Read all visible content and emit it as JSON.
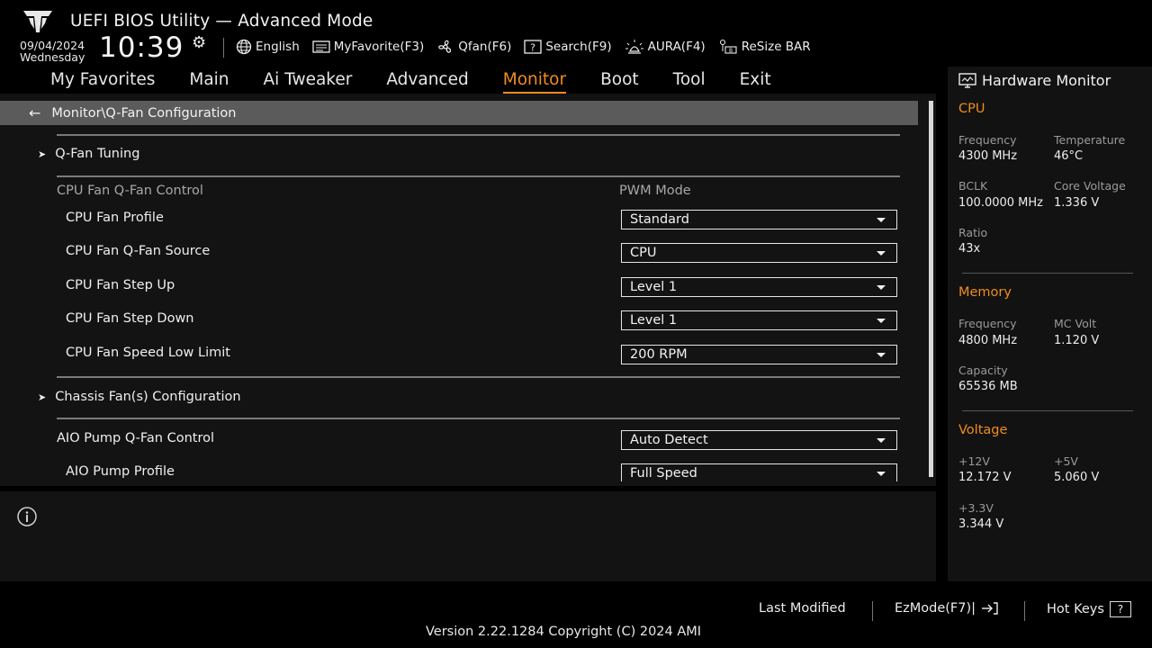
{
  "header": {
    "title": "UEFI BIOS Utility — Advanced Mode",
    "date": "09/04/2024",
    "weekday": "Wednesday",
    "time": "10:39",
    "toolbar": [
      {
        "label": "English",
        "icon": "globe-icon"
      },
      {
        "label": "MyFavorite(F3)",
        "icon": "favorite-list-icon"
      },
      {
        "label": "Qfan(F6)",
        "icon": "fan-icon"
      },
      {
        "label": "Search(F9)",
        "icon": "search-help-icon"
      },
      {
        "label": "AURA(F4)",
        "icon": "aura-light-icon"
      },
      {
        "label": "ReSize BAR",
        "icon": "resize-bar-icon"
      }
    ]
  },
  "nav": {
    "items": [
      "My Favorites",
      "Main",
      "Ai Tweaker",
      "Advanced",
      "Monitor",
      "Boot",
      "Tool",
      "Exit"
    ],
    "active": "Monitor"
  },
  "main": {
    "breadcrumb": "Monitor\\Q-Fan Configuration",
    "qfan_tuning": "Q-Fan Tuning",
    "cpu_group_label": "CPU Fan Q-Fan Control",
    "cpu_group_value": "PWM Mode",
    "cpu_rows": [
      {
        "label": "CPU Fan Profile",
        "value": "Standard"
      },
      {
        "label": "CPU Fan Q-Fan Source",
        "value": "CPU"
      },
      {
        "label": "CPU Fan Step Up",
        "value": "Level 1"
      },
      {
        "label": "CPU Fan Step Down",
        "value": "Level 1"
      },
      {
        "label": "CPU Fan Speed Low Limit",
        "value": "200 RPM"
      }
    ],
    "chassis": "Chassis Fan(s) Configuration",
    "aio_rows": [
      {
        "label": "AIO Pump Q-Fan Control",
        "value": "Auto Detect"
      },
      {
        "label": "AIO Pump Profile",
        "value": "Full Speed"
      }
    ]
  },
  "hw": {
    "title": "Hardware Monitor",
    "cpu": {
      "heading": "CPU",
      "frequency_label": "Frequency",
      "frequency": "4300 MHz",
      "temperature_label": "Temperature",
      "temperature": "46°C",
      "bclk_label": "BCLK",
      "bclk": "100.0000 MHz",
      "core_voltage_label": "Core Voltage",
      "core_voltage": "1.336 V",
      "ratio_label": "Ratio",
      "ratio": "43x"
    },
    "memory": {
      "heading": "Memory",
      "frequency_label": "Frequency",
      "frequency": "4800 MHz",
      "mc_volt_label": "MC Volt",
      "mc_volt": "1.120 V",
      "capacity_label": "Capacity",
      "capacity": "65536 MB"
    },
    "voltage": {
      "heading": "Voltage",
      "v12_label": "+12V",
      "v12": "12.172 V",
      "v5_label": "+5V",
      "v5": "5.060 V",
      "v33_label": "+3.3V",
      "v33": "3.344 V"
    }
  },
  "footer": {
    "last_modified": "Last Modified",
    "ezmode": "EzMode(F7)|",
    "hot_keys": "Hot Keys",
    "hot_keys_key": "?",
    "version": "Version 2.22.1284 Copyright (C) 2024 AMI"
  },
  "colors": {
    "accent": "#f08c1e",
    "panel": "#131313",
    "breadcrumb": "#5b5b5b"
  }
}
